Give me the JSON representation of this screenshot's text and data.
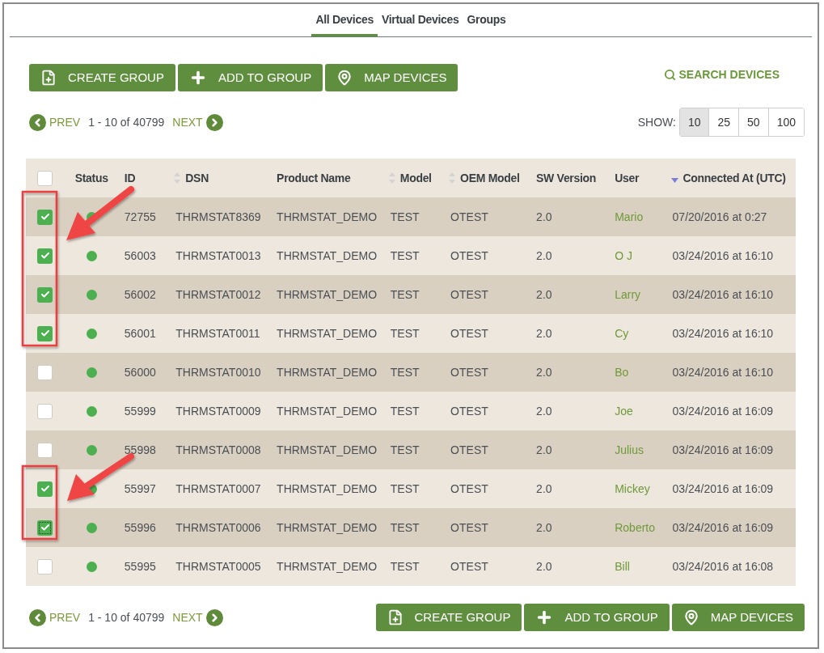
{
  "tabs": [
    {
      "label": "All Devices",
      "selected": true
    },
    {
      "label": "Virtual Devices",
      "selected": false
    },
    {
      "label": "Groups",
      "selected": false
    }
  ],
  "actions_top": [
    {
      "kind": "create",
      "label": "CREATE GROUP"
    },
    {
      "kind": "add",
      "label": "ADD TO GROUP"
    },
    {
      "kind": "map",
      "label": "MAP DEVICES"
    }
  ],
  "search": {
    "label": "SEARCH DEVICES"
  },
  "pager_top": {
    "prev": "PREV",
    "range": "1 - 10 of 40799",
    "next": "NEXT"
  },
  "show": {
    "label": "SHOW:",
    "options": [
      {
        "label": "10",
        "selected": true
      },
      {
        "label": "25",
        "selected": false
      },
      {
        "label": "50",
        "selected": false
      },
      {
        "label": "100",
        "selected": false
      }
    ]
  },
  "table": {
    "select_all": {
      "checked": false
    },
    "columns": [
      {
        "label": "Status",
        "kind": "plain"
      },
      {
        "label": "ID",
        "kind": "plain"
      },
      {
        "label": "DSN",
        "kind": "sortable"
      },
      {
        "label": "Product Name",
        "kind": "plain"
      },
      {
        "label": "Model",
        "kind": "sortable"
      },
      {
        "label": "OEM Model",
        "kind": "sortable"
      },
      {
        "label": "SW Version",
        "kind": "plain"
      },
      {
        "label": "User",
        "kind": "plain"
      },
      {
        "label": "Connected At (UTC)",
        "kind": "sorted"
      }
    ],
    "rows": [
      {
        "checked": true,
        "focused": false,
        "color": "#4caf50",
        "id": "72755",
        "dsn": "THRMSTAT8369",
        "product": "THRMSTAT_DEMO",
        "model": "TEST",
        "oem_model": "OTEST",
        "sw": "2.0",
        "user": "Mario",
        "connected": "07/20/2016 at 0:27"
      },
      {
        "checked": true,
        "focused": false,
        "color": "#4caf50",
        "id": "56003",
        "dsn": "THRMSTAT0013",
        "product": "THRMSTAT_DEMO",
        "model": "TEST",
        "oem_model": "OTEST",
        "sw": "2.0",
        "user": "O J",
        "connected": "03/24/2016 at 16:10"
      },
      {
        "checked": true,
        "focused": false,
        "color": "#4caf50",
        "id": "56002",
        "dsn": "THRMSTAT0012",
        "product": "THRMSTAT_DEMO",
        "model": "TEST",
        "oem_model": "OTEST",
        "sw": "2.0",
        "user": "Larry",
        "connected": "03/24/2016 at 16:10"
      },
      {
        "checked": true,
        "focused": false,
        "color": "#4caf50",
        "id": "56001",
        "dsn": "THRMSTAT0011",
        "product": "THRMSTAT_DEMO",
        "model": "TEST",
        "oem_model": "OTEST",
        "sw": "2.0",
        "user": "Cy",
        "connected": "03/24/2016 at 16:10"
      },
      {
        "checked": false,
        "focused": false,
        "color": "#4caf50",
        "id": "56000",
        "dsn": "THRMSTAT0010",
        "product": "THRMSTAT_DEMO",
        "model": "TEST",
        "oem_model": "OTEST",
        "sw": "2.0",
        "user": "Bo",
        "connected": "03/24/2016 at 16:10"
      },
      {
        "checked": false,
        "focused": false,
        "color": "#4caf50",
        "id": "55999",
        "dsn": "THRMSTAT0009",
        "product": "THRMSTAT_DEMO",
        "model": "TEST",
        "oem_model": "OTEST",
        "sw": "2.0",
        "user": "Joe",
        "connected": "03/24/2016 at 16:09"
      },
      {
        "checked": false,
        "focused": false,
        "color": "#4caf50",
        "id": "55998",
        "dsn": "THRMSTAT0008",
        "product": "THRMSTAT_DEMO",
        "model": "TEST",
        "oem_model": "OTEST",
        "sw": "2.0",
        "user": "Julius",
        "connected": "03/24/2016 at 16:09"
      },
      {
        "checked": true,
        "focused": false,
        "color": "#4caf50",
        "id": "55997",
        "dsn": "THRMSTAT0007",
        "product": "THRMSTAT_DEMO",
        "model": "TEST",
        "oem_model": "OTEST",
        "sw": "2.0",
        "user": "Mickey",
        "connected": "03/24/2016 at 16:09"
      },
      {
        "checked": true,
        "focused": true,
        "color": "#4caf50",
        "id": "55996",
        "dsn": "THRMSTAT0006",
        "product": "THRMSTAT_DEMO",
        "model": "TEST",
        "oem_model": "OTEST",
        "sw": "2.0",
        "user": "Roberto",
        "connected": "03/24/2016 at 16:09"
      },
      {
        "checked": false,
        "focused": false,
        "color": "#4caf50",
        "id": "55995",
        "dsn": "THRMSTAT0005",
        "product": "THRMSTAT_DEMO",
        "model": "TEST",
        "oem_model": "OTEST",
        "sw": "2.0",
        "user": "Bill",
        "connected": "03/24/2016 at 16:08"
      }
    ]
  },
  "pager_bottom": {
    "prev": "PREV",
    "range": "1 - 10 of 40799",
    "next": "NEXT"
  },
  "actions_bottom": [
    {
      "kind": "create",
      "label": "CREATE GROUP"
    },
    {
      "kind": "add",
      "label": "ADD TO GROUP"
    },
    {
      "kind": "map",
      "label": "MAP DEVICES"
    }
  ]
}
